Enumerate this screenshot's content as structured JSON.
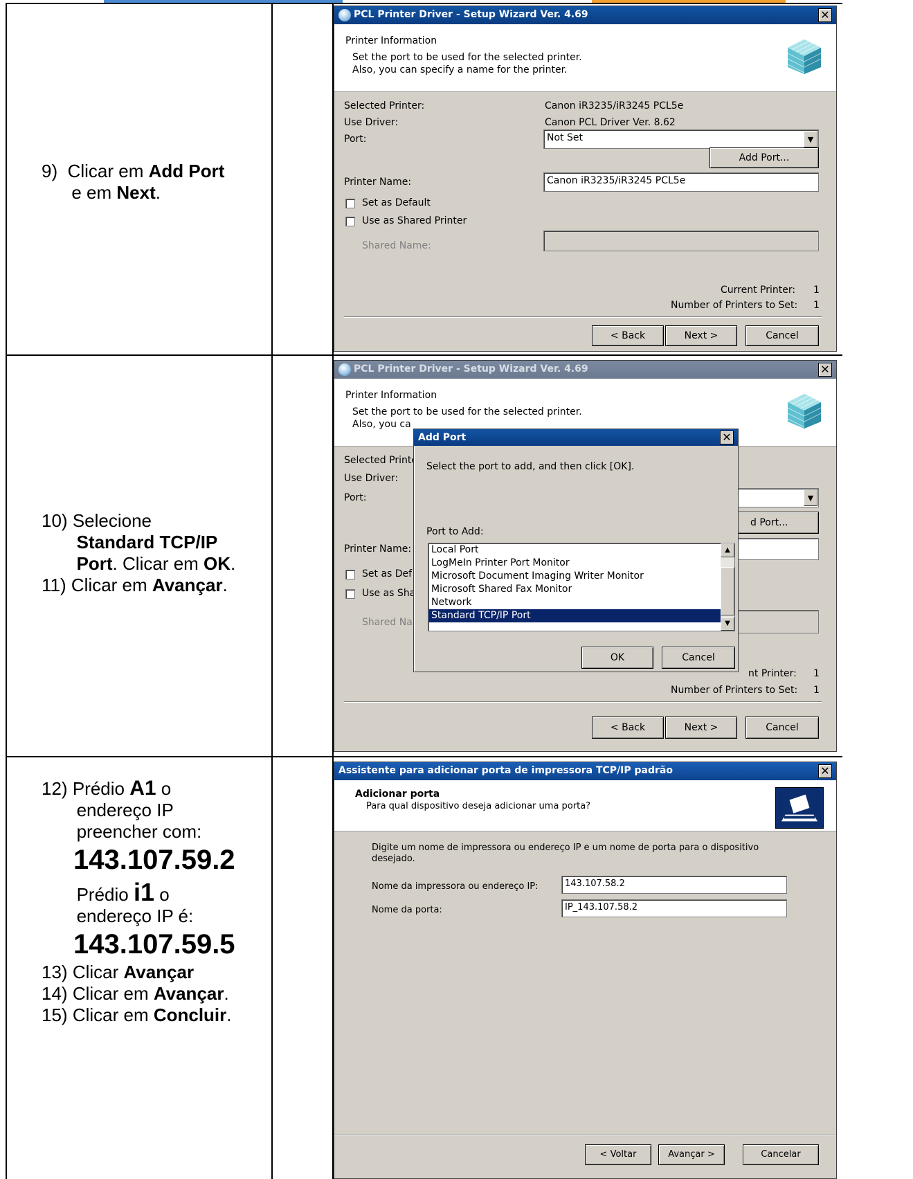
{
  "steps": {
    "step9": {
      "num": "9)",
      "pre": "Clicar em ",
      "b1": "Add Port",
      "mid": "e em ",
      "b2": "Next",
      "end": "."
    },
    "step10": {
      "num": "10)",
      "pre": "Selecione",
      "b1": "Standard TCP/IP",
      "b2": "Port",
      "mid": ". Clicar em ",
      "b3": "OK",
      "end": "."
    },
    "step11": {
      "num": "11)",
      "pre": "Clicar em ",
      "b1": "Avançar",
      "end": "."
    },
    "step12": {
      "num": "12)",
      "pre": "Prédio ",
      "b1": "A1",
      "mid": " o",
      "l2": "endereço IP",
      "l3": "preencher com:",
      "ip": "143.107.59.2"
    },
    "step12b": {
      "pre": "Prédio ",
      "b1": "i1",
      "mid": " o",
      "l2": "endereço IP é:",
      "ip": "143.107.59.5"
    },
    "step13": {
      "num": "13)",
      "pre": "Clicar ",
      "b1": "Avançar"
    },
    "step14": {
      "num": "14)",
      "pre": "Clicar em ",
      "b1": "Avançar",
      "end": "."
    },
    "step15": {
      "num": "15)",
      "pre": "Clicar em ",
      "b1": "Concluir",
      "end": "."
    }
  },
  "wizard": {
    "title": "PCL Printer Driver - Setup Wizard Ver. 4.69",
    "header_title": "Printer Information",
    "header_sub1": "Set the port to be used for the selected printer.",
    "header_sub2": "Also, you can specify a name for the printer.",
    "header_sub2_trunc": "Also, you ca",
    "selected_printer_label": "Selected Printer:",
    "selected_printer_label_trunc": "Selected Printe",
    "selected_printer_value": "Canon iR3235/iR3245 PCL5e",
    "use_driver_label": "Use Driver:",
    "use_driver_value": "Canon PCL Driver Ver. 8.62",
    "port_label": "Port:",
    "port_value": "Not Set",
    "add_port_button": "Add Port...",
    "add_port_button_trunc": "d Port...",
    "printer_name_label": "Printer Name:",
    "printer_name_value": "Canon iR3235/iR3245 PCL5e",
    "set_default_label": "Set as Default",
    "set_default_trunc": "Set as Def",
    "shared_label": "Use as Shared Printer",
    "shared_trunc": "Use as Sha",
    "shared_name_label": "Shared Name:",
    "shared_name_trunc": "Shared Na",
    "current_printer_label": "Current Printer:",
    "current_printer_trunc": "nt Printer:",
    "current_printer_value": "1",
    "num_printers_label": "Number of Printers to Set:",
    "num_printers_value": "1",
    "back_button": "< Back",
    "next_button": "Next >",
    "cancel_button": "Cancel"
  },
  "add_port_dialog": {
    "title": "Add Port",
    "instruction": "Select the port to add, and then click [OK].",
    "port_to_add_label": "Port to Add:",
    "ports": [
      "Local Port",
      "LogMeIn Printer Port Monitor",
      "Microsoft Document Imaging Writer Monitor",
      "Microsoft Shared Fax Monitor",
      "Network",
      "Standard TCP/IP Port"
    ],
    "selected_port": "Standard TCP/IP Port",
    "ok_button": "OK",
    "cancel_button": "Cancel"
  },
  "tcpip_wizard": {
    "title": "Assistente para adicionar porta de impressora TCP/IP padrão",
    "header_title": "Adicionar porta",
    "header_sub": "Para qual dispositivo deseja adicionar uma porta?",
    "instruction": "Digite um nome de impressora ou endereço IP e um nome de porta para o dispositivo desejado.",
    "ip_label": "Nome da impressora ou endereço IP:",
    "ip_value": "143.107.58.2",
    "port_name_label": "Nome da porta:",
    "port_name_value": "IP_143.107.58.2",
    "back_button": "< Voltar",
    "next_button": "Avançar >",
    "cancel_button": "Cancelar"
  },
  "colors": {
    "title_active": "#0a3c82",
    "title_inactive": "#6c7a90",
    "selection": "#0a246a",
    "dialog_bg": "#d4d0c8"
  }
}
